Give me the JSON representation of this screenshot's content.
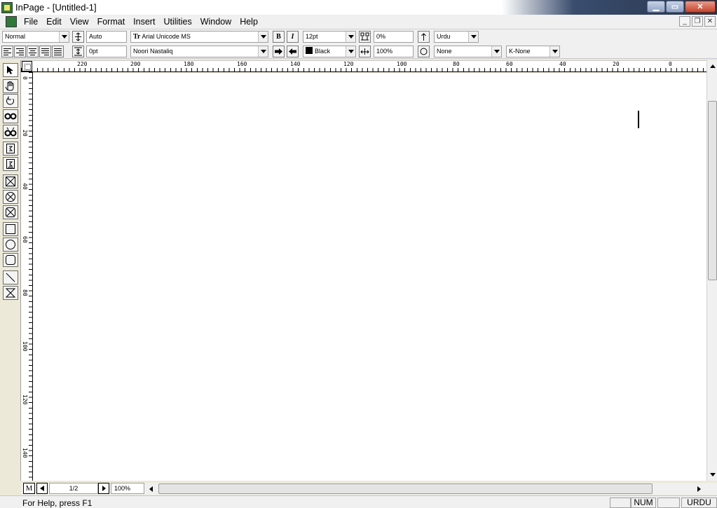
{
  "window": {
    "title": "InPage - [Untitled-1]"
  },
  "menu": [
    "File",
    "Edit",
    "View",
    "Format",
    "Insert",
    "Utilities",
    "Window",
    "Help"
  ],
  "toolbar": {
    "style": "Normal",
    "leading": "Auto",
    "font_english": "Arial Unicode MS",
    "font_english_prefix": "Tr",
    "bold_label": "B",
    "italic_label": "I",
    "size": "12pt",
    "tracking": "0%",
    "language": "Urdu",
    "indent": "0pt",
    "font_urdu": "Noori Nastaliq",
    "color": "Black",
    "scale": "100%",
    "shade": "None",
    "kerning": "K-None"
  },
  "ruler": {
    "h_labels": [
      "220",
      "200",
      "180",
      "160",
      "140",
      "120",
      "100",
      "80",
      "60",
      "40",
      "20",
      "0"
    ],
    "v_labels": [
      "0",
      "20",
      "40",
      "60",
      "80",
      "100",
      "120",
      "140"
    ]
  },
  "nav": {
    "master_label": "M",
    "page": "1/2",
    "zoom": "100%"
  },
  "status": {
    "help": "For Help, press F1",
    "num": "NUM",
    "lang": "URDU"
  }
}
